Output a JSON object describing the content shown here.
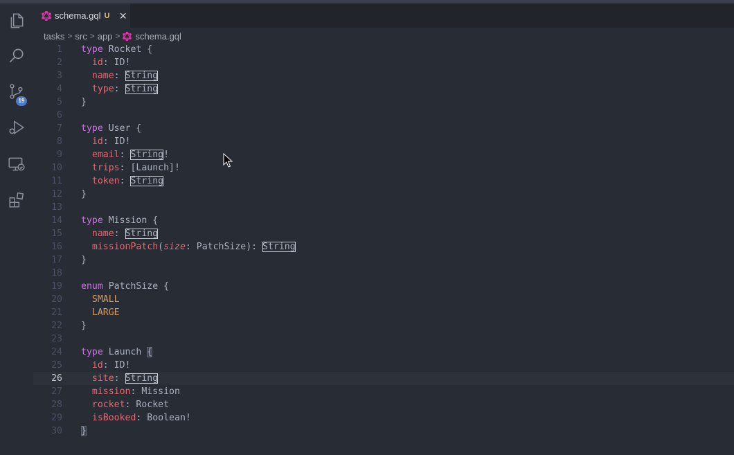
{
  "tab": {
    "title": "schema.gql",
    "status": "U",
    "close": "×"
  },
  "activity": {
    "badge": "19"
  },
  "breadcrumb": {
    "items": [
      "tasks",
      "src",
      "app"
    ],
    "file": "schema.gql",
    "separator": ">"
  },
  "colors": {
    "keyword": "#c678dd",
    "field": "#e06c75",
    "enum_value": "#d19a66",
    "text": "#abb2bf",
    "gql_pink": "#e535ab"
  },
  "editor": {
    "current_line": 26,
    "lines": [
      {
        "n": "1",
        "t": "type Rocket {"
      },
      {
        "n": "2",
        "t": "  id: ID!"
      },
      {
        "n": "3",
        "t": "  name: String"
      },
      {
        "n": "4",
        "t": "  type: String"
      },
      {
        "n": "5",
        "t": "}"
      },
      {
        "n": "6",
        "t": ""
      },
      {
        "n": "7",
        "t": "type User {"
      },
      {
        "n": "8",
        "t": "  id: ID!"
      },
      {
        "n": "9",
        "t": "  email: String!"
      },
      {
        "n": "10",
        "t": "  trips: [Launch]!"
      },
      {
        "n": "11",
        "t": "  token: String"
      },
      {
        "n": "12",
        "t": "}"
      },
      {
        "n": "13",
        "t": ""
      },
      {
        "n": "14",
        "t": "type Mission {"
      },
      {
        "n": "15",
        "t": "  name: String"
      },
      {
        "n": "16",
        "t": "  missionPatch(size: PatchSize): String"
      },
      {
        "n": "17",
        "t": "}"
      },
      {
        "n": "18",
        "t": ""
      },
      {
        "n": "19",
        "t": "enum PatchSize {"
      },
      {
        "n": "20",
        "t": "  SMALL"
      },
      {
        "n": "21",
        "t": "  LARGE"
      },
      {
        "n": "22",
        "t": "}"
      },
      {
        "n": "23",
        "t": ""
      },
      {
        "n": "24",
        "t": "type Launch {"
      },
      {
        "n": "25",
        "t": "  id: ID!"
      },
      {
        "n": "26",
        "t": "  site: String"
      },
      {
        "n": "27",
        "t": "  mission: Mission"
      },
      {
        "n": "28",
        "t": "  rocket: Rocket"
      },
      {
        "n": "29",
        "t": "  isBooked: Boolean!"
      },
      {
        "n": "30",
        "t": "}"
      }
    ]
  }
}
